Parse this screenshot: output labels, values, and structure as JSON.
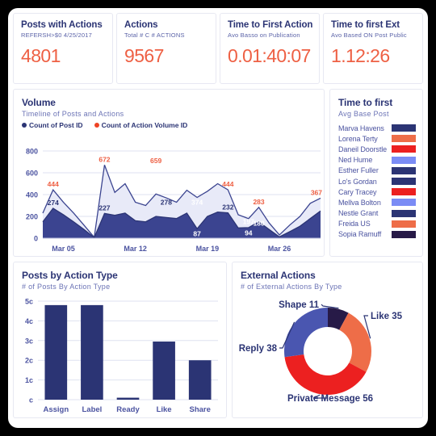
{
  "kpis": [
    {
      "title": "Posts with Actions",
      "subtitle": "REFERSH>$0 4/25/2017",
      "value": "4801"
    },
    {
      "title": "Actions",
      "subtitle": "Total # C # ACTIONS",
      "value": "9567"
    },
    {
      "title": "Time to First Action",
      "subtitle": "Avo Basso on Publication",
      "value": "0.01:40:07"
    },
    {
      "title": "Time to first Ext",
      "subtitle": "Avo Based ON Post Public",
      "value": "1.12:26"
    }
  ],
  "volume": {
    "title": "Volume",
    "subtitle": "Timeline of Posts and Actions",
    "legend": [
      {
        "label": "Count of Post ID",
        "color": "#2b3474"
      },
      {
        "label": "Count of Action Volume ID",
        "color": "#ee4324"
      }
    ]
  },
  "time_to_first": {
    "title": "Time to first",
    "subtitle": "Avg Base Post",
    "items": [
      {
        "name": "Marva Havens",
        "color": "#2b3474"
      },
      {
        "name": "Lorena Terty",
        "color": "#ee6d48"
      },
      {
        "name": "Daneil Doorstle",
        "color": "#ec2020"
      },
      {
        "name": "Ned Hume",
        "color": "#7b8cf5"
      },
      {
        "name": "Esther Fuller",
        "color": "#2b3474"
      },
      {
        "name": "Lo's Gordan",
        "color": "#2b3474"
      },
      {
        "name": "Cary Tracey",
        "color": "#ec2020"
      },
      {
        "name": "Mellva Bolton",
        "color": "#7b8cf5"
      },
      {
        "name": "Nestle Grant",
        "color": "#2b3474"
      },
      {
        "name": "Freida US",
        "color": "#ee6d48"
      },
      {
        "name": "Sopia Ramuff",
        "color": "#271a47"
      }
    ]
  },
  "posts_by_action": {
    "title": "Posts by Action Type",
    "subtitle": "# of Posts By Action Type"
  },
  "external_actions": {
    "title": "External Actions",
    "subtitle": "# of External Actions By Type"
  },
  "chart_data": [
    {
      "type": "area",
      "id": "volume-timeline",
      "title": "Volume",
      "subtitle": "Timeline of Posts and Actions",
      "xlabel": "",
      "ylabel": "",
      "ylim": [
        0,
        800
      ],
      "yticks": [
        0,
        200,
        400,
        600,
        800
      ],
      "grid": true,
      "legend_position": "top-left",
      "xticks": [
        "Mar 05",
        "Mar 12",
        "Mar 19",
        "Mar 26"
      ],
      "xtick_index": [
        2,
        9,
        16,
        23
      ],
      "x": [
        "1",
        "2",
        "3",
        "4",
        "5",
        "6",
        "7",
        "8",
        "9",
        "10",
        "11",
        "12",
        "13",
        "14",
        "15",
        "16",
        "17",
        "18",
        "19",
        "20",
        "21",
        "22",
        "23",
        "24",
        "25",
        "26",
        "27",
        "28"
      ],
      "series": [
        {
          "name": "Count of Action Volume ID",
          "color": "#e8eaf8",
          "line_color": "#3b4490",
          "values": [
            230,
            444,
            330,
            230,
            120,
            8,
            672,
            420,
            500,
            330,
            300,
            405,
            370,
            330,
            440,
            374,
            430,
            500,
            444,
            215,
            180,
            283,
            140,
            30,
            120,
            200,
            320,
            367
          ]
        },
        {
          "name": "Count of Post ID",
          "color": "#3b4490",
          "line_color": "#2b3474",
          "values": [
            150,
            274,
            215,
            150,
            80,
            5,
            227,
            210,
            230,
            160,
            150,
            200,
            190,
            180,
            230,
            87,
            200,
            240,
            232,
            94,
            97,
            150,
            80,
            12,
            60,
            110,
            180,
            250
          ]
        }
      ],
      "annotations": [
        {
          "text": "444",
          "value": 444,
          "index": 1,
          "color": "#ee6044"
        },
        {
          "text": "274",
          "value": 274,
          "index": 1,
          "color": "#2b3474"
        },
        {
          "text": "672",
          "value": 672,
          "index": 6,
          "color": "#ee6044"
        },
        {
          "text": "227",
          "value": 227,
          "index": 6,
          "color": "#2b3474"
        },
        {
          "text": "659",
          "value": 659,
          "index": 11,
          "color": "#ee6044"
        },
        {
          "text": "278",
          "value": 278,
          "index": 12,
          "color": "#2b3474"
        },
        {
          "text": "374",
          "value": 374,
          "index": 15,
          "color": "#ffffff"
        },
        {
          "text": "87",
          "value": 87,
          "index": 15,
          "color": "#ffffff"
        },
        {
          "text": "444",
          "value": 444,
          "index": 18,
          "color": "#ee6044"
        },
        {
          "text": "232",
          "value": 232,
          "index": 18,
          "color": "#2b3474"
        },
        {
          "text": "197",
          "value": 197,
          "index": 20,
          "color": "#ffffff"
        },
        {
          "text": "94",
          "value": 94,
          "index": 20,
          "color": "#ffffff"
        },
        {
          "text": "283",
          "value": 283,
          "index": 21,
          "color": "#ee6044"
        },
        {
          "text": "180",
          "value": 180,
          "index": 21,
          "color": "#ffffff"
        },
        {
          "text": "367",
          "value": 367,
          "index": 27,
          "color": "#ee6044"
        }
      ]
    },
    {
      "type": "bar",
      "id": "posts-by-action-type",
      "title": "Posts by Action Type",
      "subtitle": "# of Posts By Action Type",
      "categories": [
        "Assign",
        "Label",
        "Ready",
        "Like",
        "Share"
      ],
      "values": [
        4.8,
        4.8,
        0.1,
        2.95,
        2.0
      ],
      "bar_color": "#2b3474",
      "xlabel": "",
      "ylabel": "",
      "ylim": [
        0,
        5
      ],
      "yticks": [
        0,
        1,
        2,
        3,
        4,
        5
      ],
      "ytick_labels": [
        "c",
        "1c",
        "2c",
        "3c",
        "4c",
        "5c"
      ],
      "grid": true
    },
    {
      "type": "pie",
      "id": "external-actions-donut",
      "title": "External Actions",
      "subtitle": "# of External Actions By Type",
      "donut": true,
      "labels": [
        "Like",
        "Private Message",
        "Reply",
        "Shape"
      ],
      "values": [
        35,
        56,
        38,
        11
      ],
      "colors": [
        "#ee6d48",
        "#ec2020",
        "#4a56b0",
        "#271a47"
      ],
      "data_labels": [
        "Like 35",
        "Private Message 56",
        "Reply 38",
        "Shape 11"
      ],
      "label_color": "#2b3474"
    }
  ]
}
